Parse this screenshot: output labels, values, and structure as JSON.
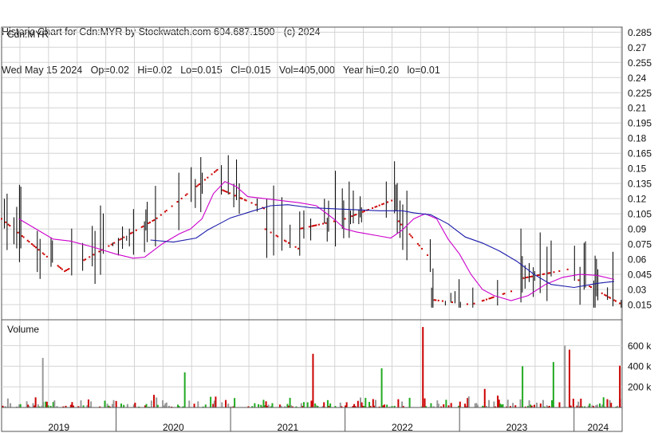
{
  "header": {
    "line1": "Historic Chart for Cdn:MYR by Stockwatch.com 604.687.1500 - (c) 2024",
    "line2": "Wed May 15 2024   Op=0.02   Hi=0.02   Lo=0.015   Cl=0.015   Vol=405,000   Year hi=0.20   lo=0.01"
  },
  "colors": {
    "candle": "#000000",
    "dot": "#cc0000",
    "ma_short": "#cc00cc",
    "ma_long": "#1a1aaa",
    "vol_up": "#22aa22",
    "vol_down": "#cc0000",
    "vol_flat": "#999999",
    "grid": "#d4d4d4",
    "frame": "#555555"
  },
  "chart_data": [
    {
      "type": "line",
      "panel": "price",
      "title": "Cdn:MYR",
      "ylim": [
        0.0,
        0.29
      ],
      "yticks": [
        0.285,
        0.27,
        0.255,
        0.24,
        0.225,
        0.21,
        0.195,
        0.18,
        0.165,
        0.15,
        0.135,
        0.12,
        0.105,
        0.09,
        0.075,
        0.06,
        0.045,
        0.03,
        0.015
      ],
      "xlim": [
        2019.0,
        2024.42
      ],
      "xticks": [
        2019,
        2020,
        2021,
        2022,
        2023,
        2024
      ],
      "grid": true,
      "series": [
        {
          "kind": "ma_short",
          "x": [
            2019.15,
            2019.3,
            2019.45,
            2019.6,
            2019.8,
            2020.0,
            2020.15,
            2020.25,
            2020.4,
            2020.55,
            2020.65,
            2020.75,
            2020.85,
            2020.95,
            2021.05,
            2021.15,
            2021.3,
            2021.45,
            2021.6,
            2021.75,
            2021.9,
            2022.0,
            2022.1,
            2022.2,
            2022.3,
            2022.4,
            2022.5,
            2022.6,
            2022.7,
            2022.8,
            2022.9,
            2023.0,
            2023.1,
            2023.2,
            2023.3,
            2023.45,
            2023.6,
            2023.75,
            2023.9,
            2024.05,
            2024.2,
            2024.35
          ],
          "values": [
            0.1,
            0.09,
            0.08,
            0.078,
            0.072,
            0.065,
            0.061,
            0.062,
            0.075,
            0.085,
            0.09,
            0.1,
            0.125,
            0.137,
            0.132,
            0.122,
            0.12,
            0.118,
            0.116,
            0.113,
            0.1,
            0.09,
            0.087,
            0.085,
            0.083,
            0.081,
            0.089,
            0.1,
            0.105,
            0.1,
            0.08,
            0.065,
            0.045,
            0.03,
            0.024,
            0.019,
            0.024,
            0.035,
            0.042,
            0.045,
            0.044,
            0.04
          ]
        },
        {
          "kind": "ma_long",
          "x": [
            2020.3,
            2020.5,
            2020.7,
            2020.8,
            2020.9,
            2021.0,
            2021.2,
            2021.35,
            2021.5,
            2021.7,
            2021.9,
            2022.1,
            2022.3,
            2022.5,
            2022.6,
            2022.75,
            2022.9,
            2023.05,
            2023.2,
            2023.35,
            2023.5,
            2023.65,
            2023.8,
            2024.0,
            2024.2,
            2024.35
          ],
          "values": [
            0.079,
            0.077,
            0.081,
            0.089,
            0.095,
            0.101,
            0.108,
            0.113,
            0.114,
            0.111,
            0.11,
            0.109,
            0.108,
            0.108,
            0.106,
            0.104,
            0.095,
            0.082,
            0.076,
            0.068,
            0.058,
            0.045,
            0.035,
            0.032,
            0.036,
            0.038
          ]
        }
      ]
    },
    {
      "type": "bar",
      "panel": "volume",
      "title": "Volume",
      "ylim": [
        0,
        850000
      ],
      "yticks": [
        200000,
        400000,
        600000
      ],
      "yticklabels": [
        "200 k",
        "400 k",
        "600 k"
      ],
      "xlim": [
        2019.0,
        2024.42
      ],
      "xticks": [
        2019,
        2020,
        2021,
        2022,
        2023,
        2024
      ],
      "xticklabels": [
        "2019",
        "2020",
        "2021",
        "2022",
        "2023",
        "2024"
      ],
      "grid": true
    }
  ]
}
